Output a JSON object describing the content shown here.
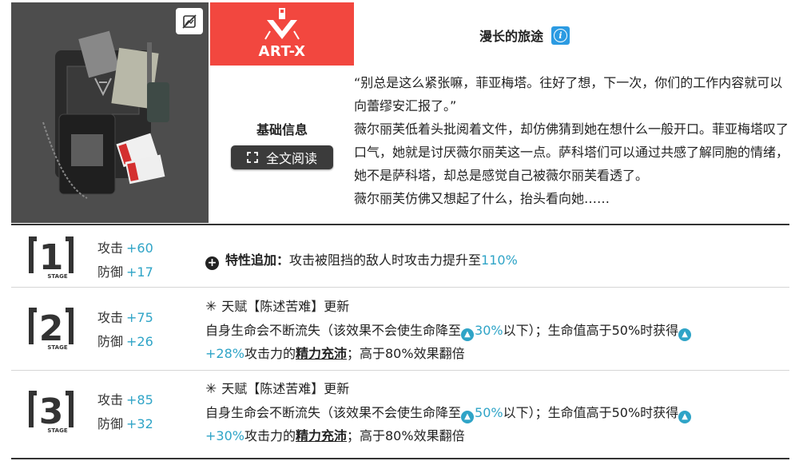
{
  "module": {
    "name": "ART-X",
    "brand_color": "#f2473f",
    "image_alt_icon": "image-toggle-icon",
    "basic_info_title": "基础信息",
    "read_full_label": "全文阅读",
    "story_title": "漫长的旅途",
    "story_paragraphs": [
      "“别总是这么紧张嘛，菲亚梅塔。往好了想，下一次，你们的工作内容就可以向蕾缪安汇报了。”",
      "薇尔丽芙低着头批阅着文件，却仿佛猜到她在想什么一般开口。菲亚梅塔叹了口气，她就是讨厌薇尔丽芙这一点。萨科塔们可以通过共感了解同胞的情绪，她不是萨科塔，却总是感觉自己被薇尔丽芙看透了。",
      "薇尔丽芙仿佛又想起了什么，抬头看向她……"
    ]
  },
  "stages": [
    {
      "stage": "1",
      "stage_label": "STAGE",
      "atk_label": "攻击",
      "atk_value": "+60",
      "def_label": "防御",
      "def_value": "+17",
      "trait_label": "特性追加：",
      "trait_text": "攻击被阻挡的敌人时攻击力提升至",
      "trait_value": "110%"
    },
    {
      "stage": "2",
      "stage_label": "STAGE",
      "atk_label": "攻击",
      "atk_value": "+75",
      "def_label": "防御",
      "def_value": "+26",
      "talent_header": "天赋【陈述苦难】更新",
      "line1_a": "自身生命会不断流失（该效果不会使生命降至",
      "line1_val": "30%",
      "line1_b": "以下）；生命值高于50%时获得",
      "line2_val": "+28%",
      "line2_a": "攻击力的",
      "keyword": "精力充沛",
      "line2_b": "；高于80%效果翻倍"
    },
    {
      "stage": "3",
      "stage_label": "STAGE",
      "atk_label": "攻击",
      "atk_value": "+85",
      "def_label": "防御",
      "def_value": "+32",
      "talent_header": "天赋【陈述苦难】更新",
      "line1_a": "自身生命会不断流失（该效果不会使生命降至",
      "line1_val": "50%",
      "line1_b": "以下）；生命值高于50%时获得",
      "line2_val": "+30%",
      "line2_a": "攻击力的",
      "keyword": "精力充沛",
      "line2_b": "；高于80%效果翻倍"
    }
  ],
  "colors": {
    "highlight": "#2fa4c7",
    "dark_button": "#3b3b3b"
  }
}
